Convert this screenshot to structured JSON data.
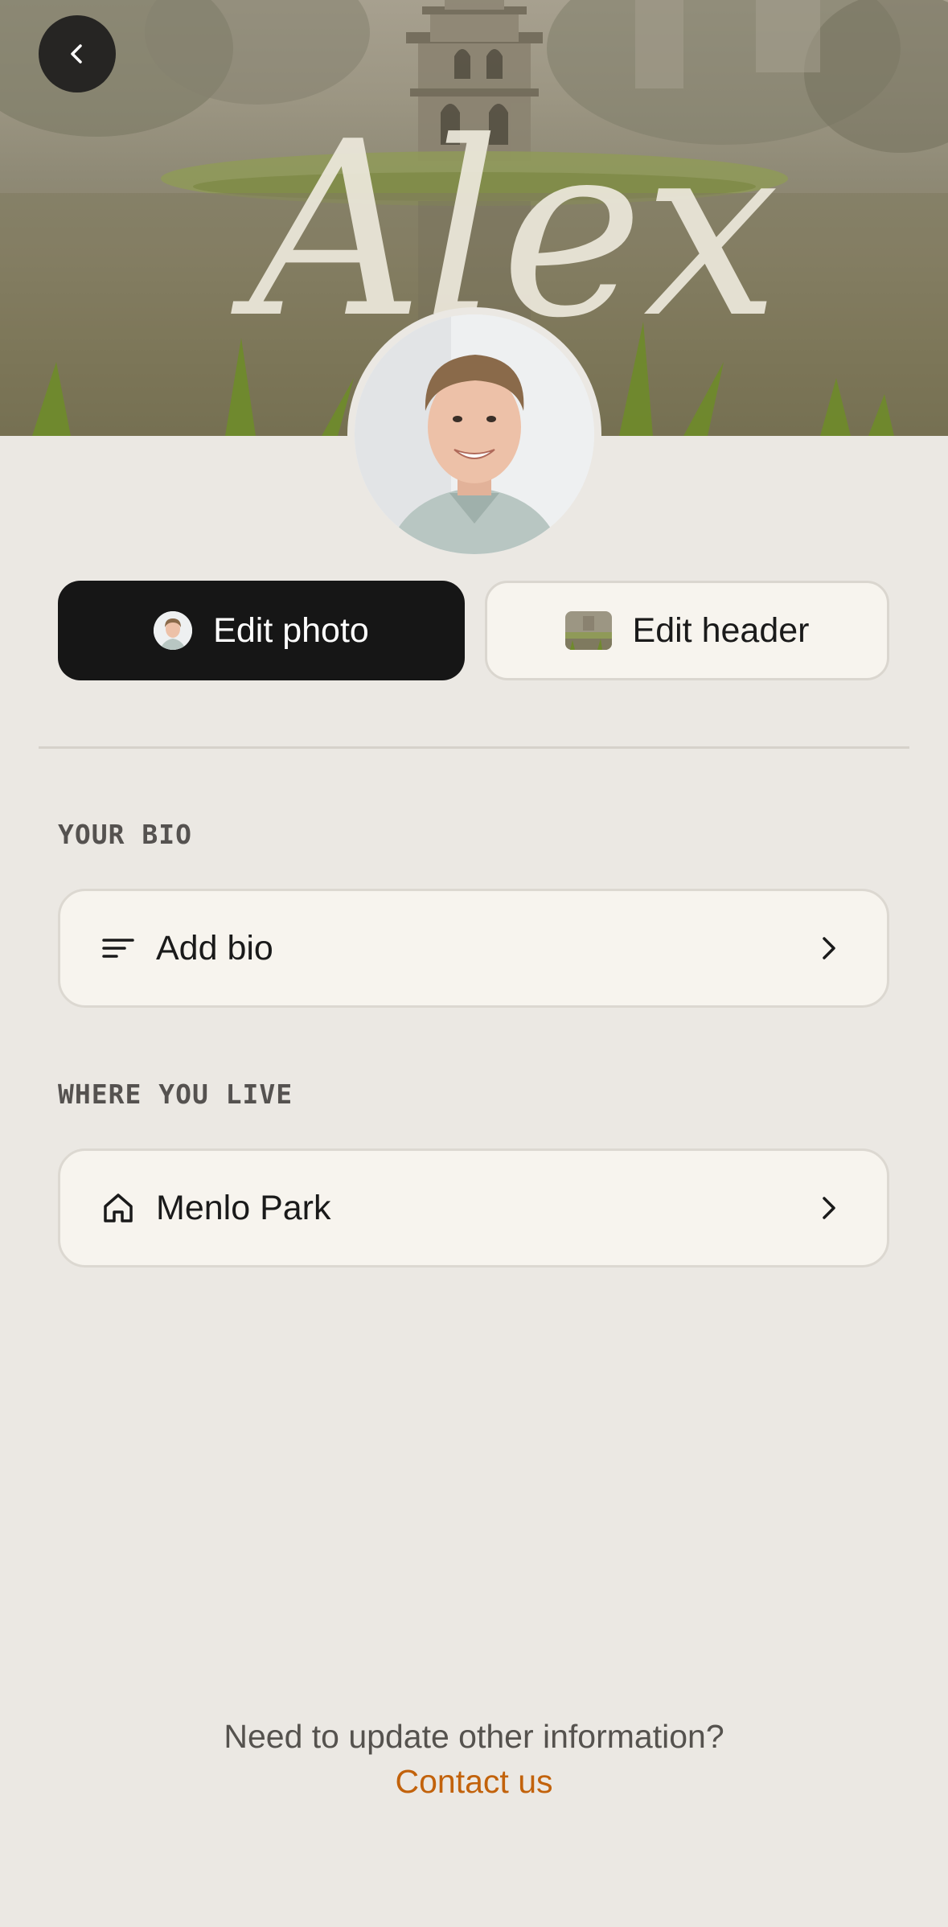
{
  "header": {
    "name_overlay": "Alex",
    "back_icon": "chevron-left-icon"
  },
  "actions": {
    "edit_photo_label": "Edit photo",
    "edit_header_label": "Edit header"
  },
  "bio": {
    "section_label": "YOUR BIO",
    "row_label": "Add bio",
    "icon": "text-lines-icon"
  },
  "location": {
    "section_label": "WHERE YOU LIVE",
    "row_label": "Menlo Park",
    "icon": "home-icon"
  },
  "footer": {
    "prompt": "Need to update other information?",
    "link": "Contact us"
  },
  "colors": {
    "background": "#ebe8e3",
    "card": "#f7f4ee",
    "primary_button": "#161616",
    "link": "#c2620b"
  }
}
